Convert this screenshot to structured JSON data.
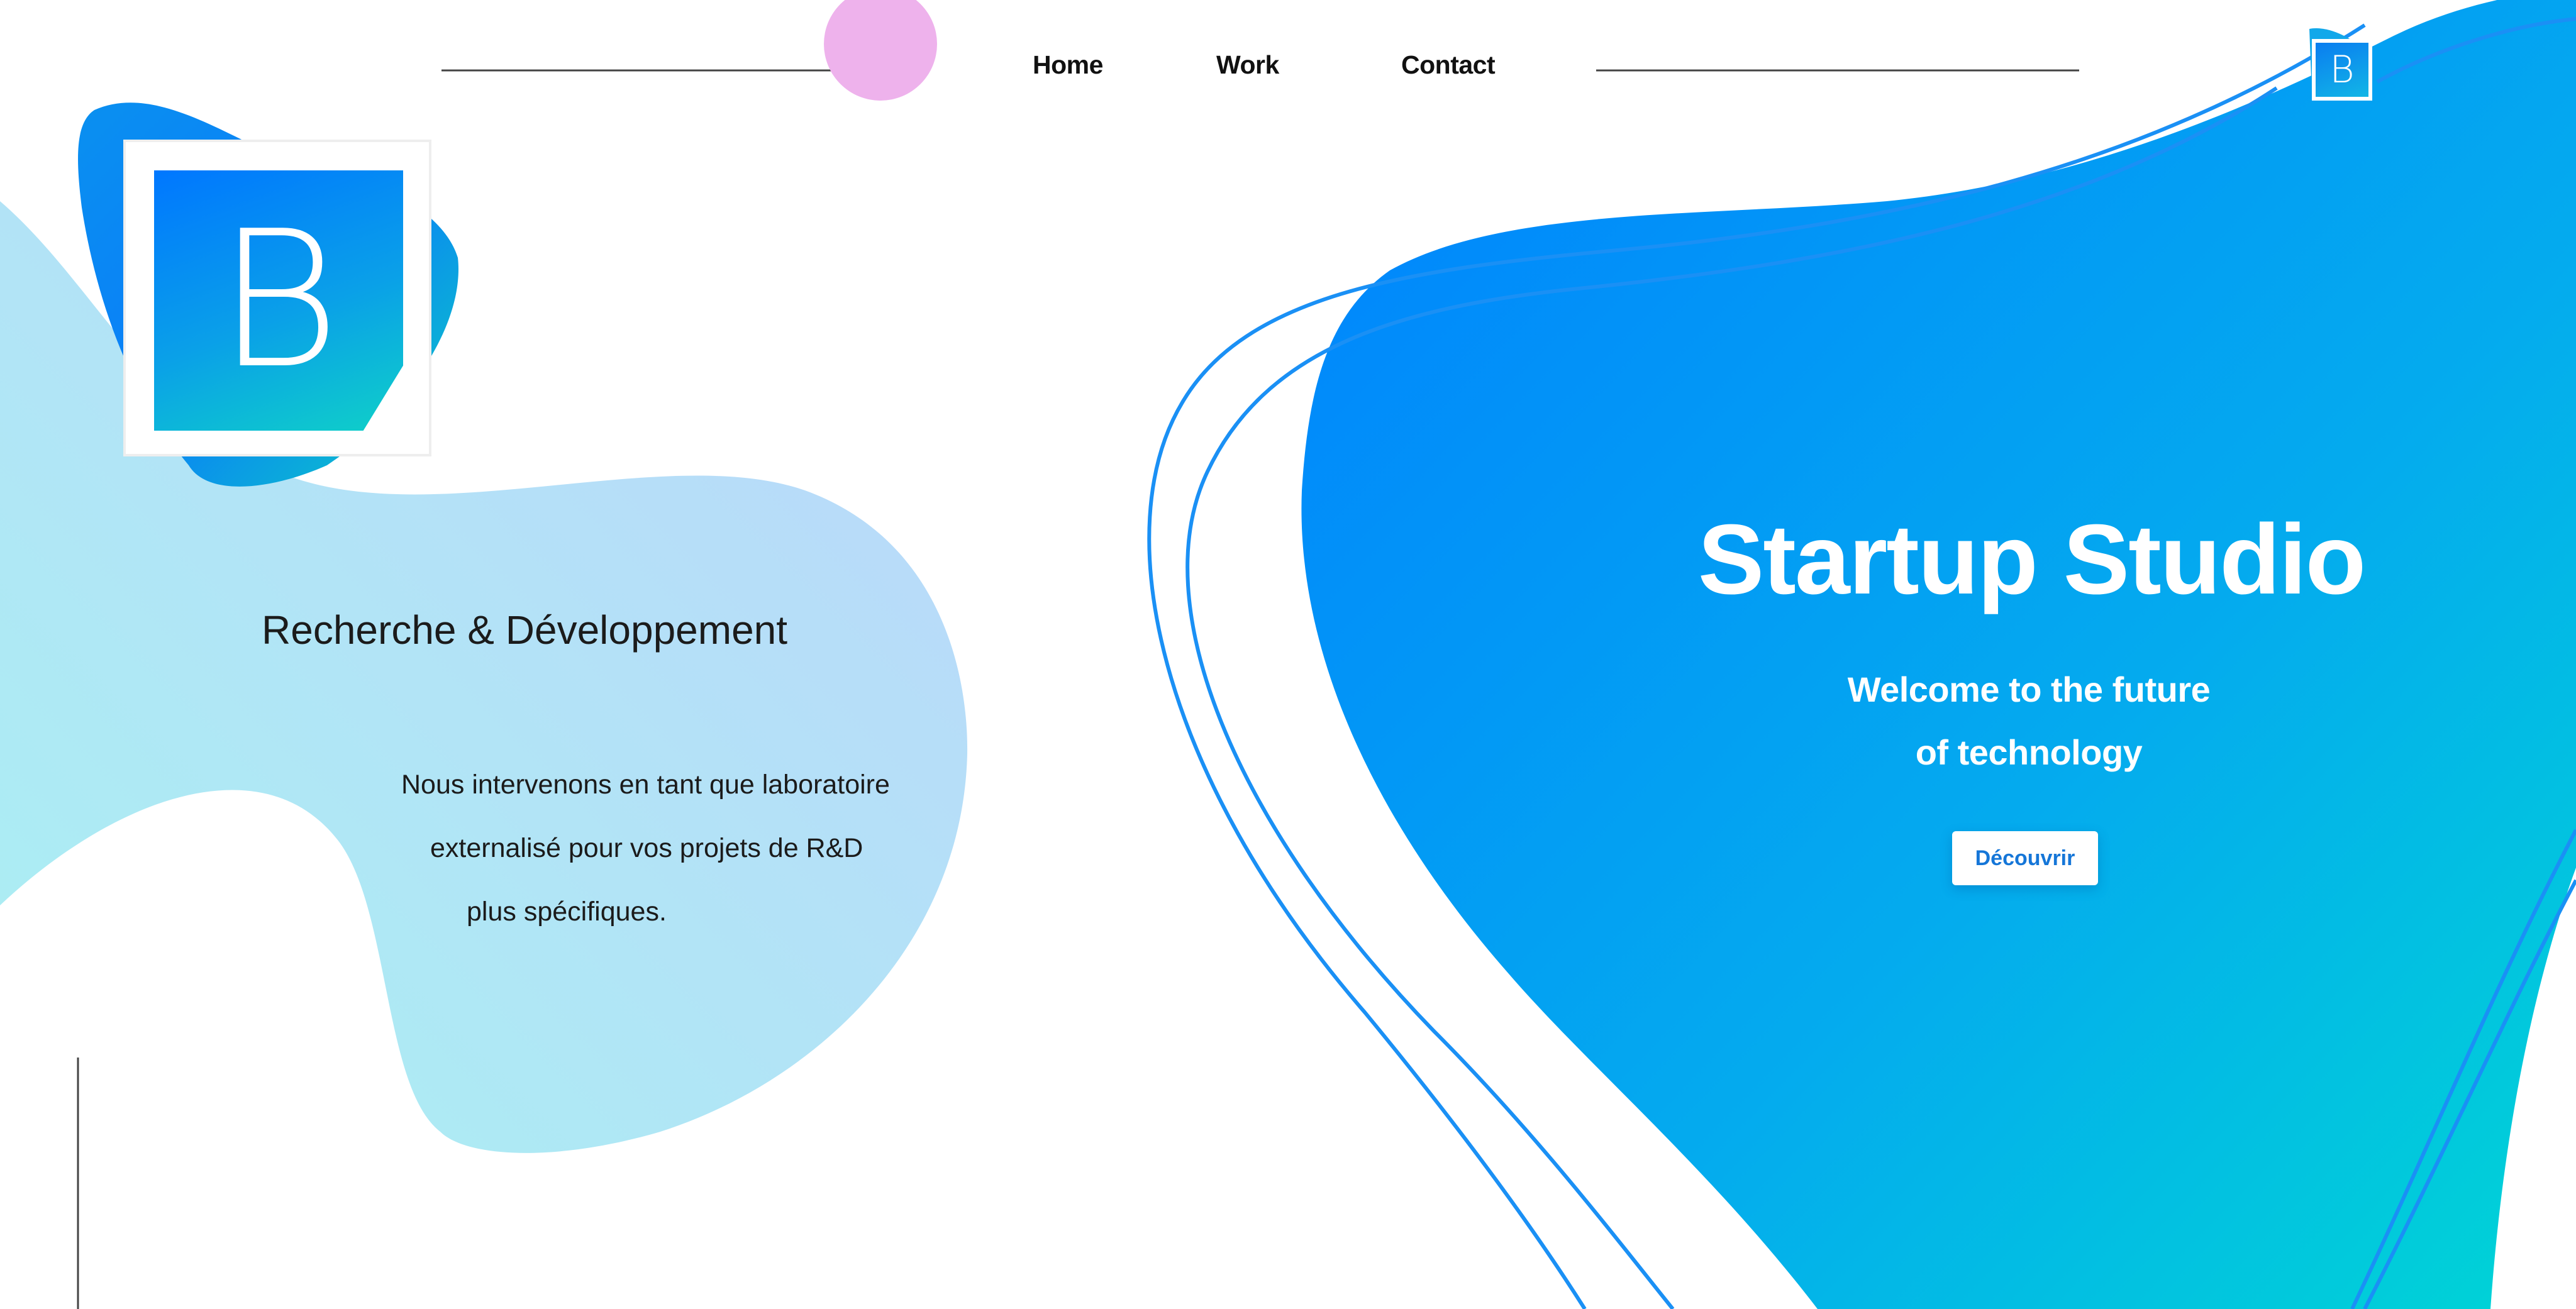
{
  "nav": {
    "home": "Home",
    "work": "Work",
    "contact": "Contact"
  },
  "logo": {
    "letter": "B",
    "small_letter": "B"
  },
  "left_section": {
    "title": "Recherche & Développement",
    "lines": [
      "Nous intervenons en tant que laboratoire",
      "externalisé pour vos projets de R&D",
      "plus spécifiques."
    ]
  },
  "hero": {
    "title": "Startup Studio",
    "subtitle_line1": "Welcome to the future",
    "subtitle_line2": "of technology",
    "cta_label": "Découvrir"
  },
  "colors": {
    "accent_blue": "#0086ff",
    "accent_cyan": "#00d4d8",
    "light_blob": "#aeeaf4",
    "pink_dot": "#eeb2ec",
    "cta_text": "#1576d8"
  }
}
